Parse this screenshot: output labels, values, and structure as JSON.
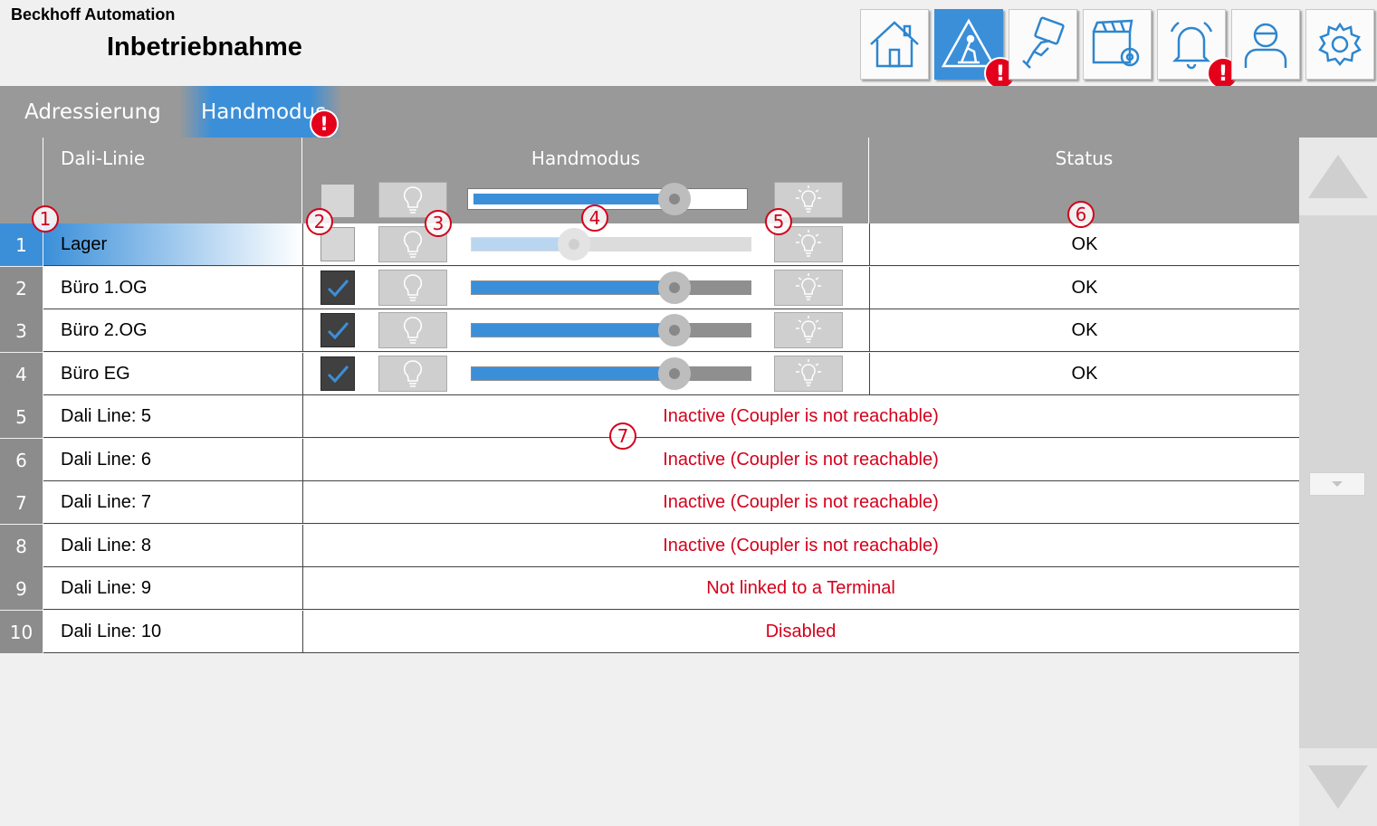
{
  "header": {
    "company": "Beckhoff Automation",
    "title": "Inbetriebnahme"
  },
  "nav": [
    {
      "icon": "home-icon",
      "active": false,
      "alert": false
    },
    {
      "icon": "construction-warning-icon",
      "active": true,
      "alert": true
    },
    {
      "icon": "hand-touch-icon",
      "active": false,
      "alert": false
    },
    {
      "icon": "scene-settings-icon",
      "active": false,
      "alert": false
    },
    {
      "icon": "alarm-bell-icon",
      "active": false,
      "alert": true
    },
    {
      "icon": "user-icon",
      "active": false,
      "alert": false
    },
    {
      "icon": "gear-icon",
      "active": false,
      "alert": false
    }
  ],
  "alert_symbol": "!",
  "tabs": [
    {
      "label": "Adressierung",
      "active": false
    },
    {
      "label": "Handmodus",
      "active": true,
      "alert": true
    }
  ],
  "table": {
    "headers": {
      "name": "Dali-Linie",
      "hand": "Handmodus",
      "status": "Status"
    },
    "header_controls": {
      "checkbox_checked": false,
      "slider_value": 0.72
    },
    "rows": [
      {
        "num": "1",
        "name": "Lager",
        "selected": true,
        "checked": false,
        "level": 0.36,
        "status": "OK",
        "dim": true
      },
      {
        "num": "2",
        "name": "Büro 1.OG",
        "checked": true,
        "level": 0.72,
        "status": "OK"
      },
      {
        "num": "3",
        "name": "Büro 2.OG",
        "checked": true,
        "level": 0.72,
        "status": "OK"
      },
      {
        "num": "4",
        "name": "Büro EG",
        "checked": true,
        "level": 0.72,
        "status": "OK"
      },
      {
        "num": "5",
        "name": "Dali Line: 5",
        "message": "Inactive (Coupler is not reachable)"
      },
      {
        "num": "6",
        "name": "Dali Line: 6",
        "message": "Inactive (Coupler is not reachable)"
      },
      {
        "num": "7",
        "name": "Dali Line: 7",
        "message": "Inactive (Coupler is not reachable)"
      },
      {
        "num": "8",
        "name": "Dali Line: 8",
        "message": "Inactive (Coupler is not reachable)"
      },
      {
        "num": "9",
        "name": "Dali Line: 9",
        "message": "Not linked to a Terminal"
      },
      {
        "num": "10",
        "name": "Dali Line: 10",
        "message": "Disabled"
      }
    ]
  },
  "markers": [
    "1",
    "2",
    "3",
    "4",
    "5",
    "6",
    "7"
  ],
  "colors": {
    "accent": "#3b8fd9",
    "alert": "#e4001b",
    "error_text": "#d4001b",
    "header_gray": "#999999"
  }
}
